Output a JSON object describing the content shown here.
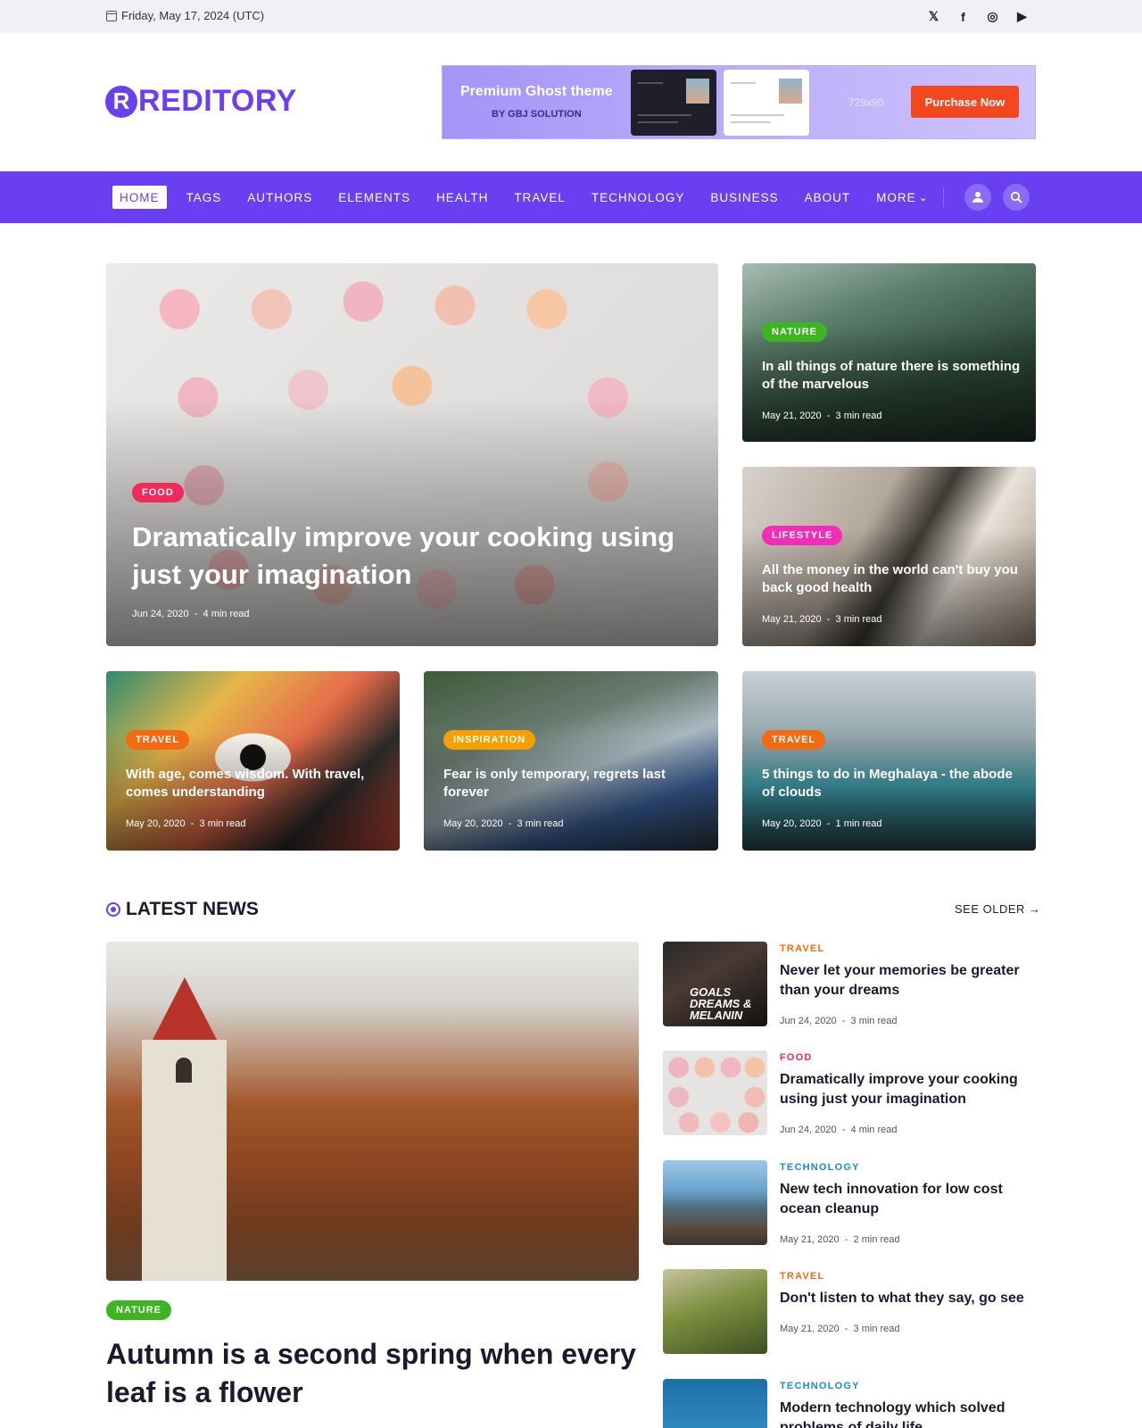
{
  "topbar": {
    "date": "Friday, May 17, 2024 (UTC)",
    "social": [
      {
        "name": "x-icon",
        "glyph": "𝕏"
      },
      {
        "name": "facebook-icon",
        "glyph": "f"
      },
      {
        "name": "instagram-icon",
        "glyph": "◎"
      },
      {
        "name": "youtube-icon",
        "glyph": "▶"
      }
    ]
  },
  "logo": {
    "mark": "R",
    "word": "REDITORY"
  },
  "banner": {
    "title": "Premium Ghost theme",
    "subtitle": "BY GBJ SOLUTION",
    "size": "728x90",
    "cta": "Purchase Now"
  },
  "nav": {
    "items": [
      "HOME",
      "TAGS",
      "AUTHORS",
      "ELEMENTS",
      "HEALTH",
      "TRAVEL",
      "TECHNOLOGY",
      "BUSINESS",
      "ABOUT",
      "MORE"
    ],
    "more_caret": "⌄"
  },
  "featured": [
    {
      "tag": "FOOD",
      "title": "Dramatically improve your cooking using just your imagination",
      "date": "Jun 24, 2020",
      "read": "4 min read"
    },
    {
      "tag": "NATURE",
      "title": "In all things of nature there is something of the marvelous",
      "date": "May 21, 2020",
      "read": "3 min read"
    },
    {
      "tag": "LIFESTYLE",
      "title": "All the money in the world can't buy you back good health",
      "date": "May 21, 2020",
      "read": "3 min read"
    },
    {
      "tag": "TRAVEL",
      "title": "With age, comes wisdom. With travel, comes understanding",
      "date": "May 20, 2020",
      "read": "3 min read"
    },
    {
      "tag": "INSPIRATION",
      "title": "Fear is only temporary, regrets last forever",
      "date": "May 20, 2020",
      "read": "3 min read"
    },
    {
      "tag": "TRAVEL",
      "title": "5 things to do in Meghalaya - the abode of clouds",
      "date": "May 20, 2020",
      "read": "1 min read"
    }
  ],
  "tag_colors": {
    "FOOD": "#f2295b",
    "NATURE": "#3cb521",
    "LIFESTYLE": "#f22eb8",
    "TRAVEL": "#f26a12",
    "INSPIRATION": "#f5a000",
    "TECHNOLOGY": "#1c8ad6"
  },
  "latest": {
    "heading": "LATEST NEWS",
    "see_older": "SEE OLDER →",
    "main": {
      "tag": "NATURE",
      "title": "Autumn is a second spring when every leaf is a flower"
    },
    "list": [
      {
        "tag": "TRAVEL",
        "title": "Never let your memories be greater than your dreams",
        "date": "Jun 24, 2020",
        "read": "3 min read"
      },
      {
        "tag": "FOOD",
        "title": "Dramatically improve your cooking using just your imagination",
        "date": "Jun 24, 2020",
        "read": "4 min read"
      },
      {
        "tag": "TECHNOLOGY",
        "title": "New tech innovation for low cost ocean cleanup",
        "date": "May 21, 2020",
        "read": "2 min read"
      },
      {
        "tag": "TRAVEL",
        "title": "Don't listen to what they say, go see",
        "date": "May 21, 2020",
        "read": "3 min read"
      },
      {
        "tag": "TECHNOLOGY",
        "title": "Modern technology which solved problems of daily life",
        "date": "",
        "read": ""
      }
    ],
    "thumb_text": "GOALS DREAMS & MELANIN"
  },
  "colors": {
    "brand": "#6a3ff2",
    "cta": "#f2471f"
  }
}
